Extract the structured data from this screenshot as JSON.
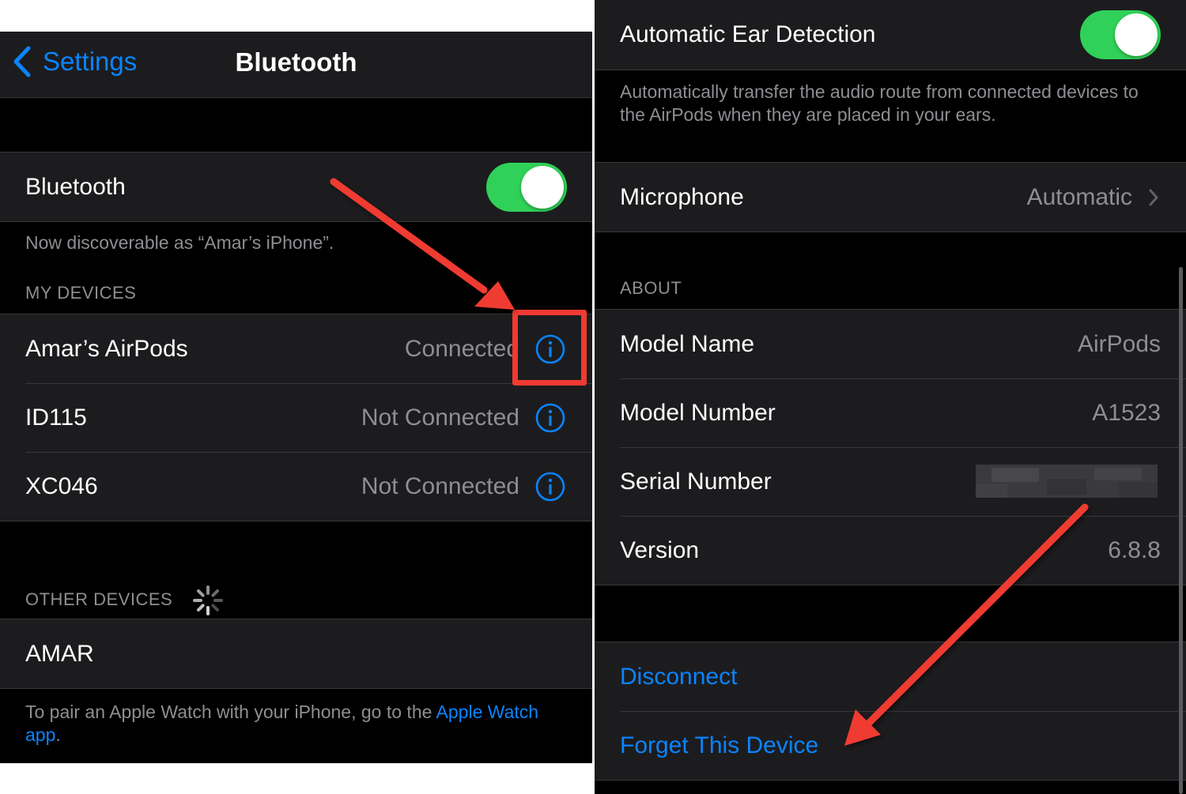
{
  "left": {
    "back_label": "Settings",
    "title": "Bluetooth",
    "bluetooth_label": "Bluetooth",
    "bluetooth_on": true,
    "discoverable_note": "Now discoverable as “Amar’s iPhone”.",
    "my_devices_header": "MY DEVICES",
    "devices": [
      {
        "name": "Amar’s AirPods",
        "status": "Connected"
      },
      {
        "name": "ID115",
        "status": "Not Connected"
      },
      {
        "name": "XC046",
        "status": "Not Connected"
      }
    ],
    "other_devices_header": "OTHER DEVICES",
    "other_devices": [
      {
        "name": "AMAR"
      }
    ],
    "pair_note": "To pair an Apple Watch with your iPhone, go to the ",
    "pair_link": "Apple Watch app",
    "pair_end": "."
  },
  "right": {
    "ear_detection_label": "Automatic Ear Detection",
    "ear_detection_on": true,
    "ear_detection_note": "Automatically transfer the audio route from connected devices to the AirPods when they are placed in your ears.",
    "microphone_label": "Microphone",
    "microphone_value": "Automatic",
    "about_header": "ABOUT",
    "about": [
      {
        "label": "Model Name",
        "value": "AirPods"
      },
      {
        "label": "Model Number",
        "value": "A1523"
      },
      {
        "label": "Serial Number",
        "value": ""
      },
      {
        "label": "Version",
        "value": "6.8.8"
      }
    ],
    "disconnect_label": "Disconnect",
    "forget_label": "Forget This Device"
  },
  "colors": {
    "accent": "#0a84ff",
    "toggle_on": "#30d158",
    "annotation": "#f03a32"
  },
  "icons": [
    "chevron-left-icon",
    "info-icon",
    "spinner-icon",
    "chevron-right-icon"
  ]
}
